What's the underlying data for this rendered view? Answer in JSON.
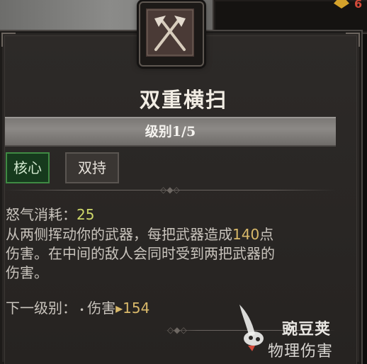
{
  "top_right": {
    "currency_icon": "gold-diamond-icon",
    "value": "6"
  },
  "skill": {
    "icon": "axes-crossed-icon",
    "name": "双重横扫",
    "level_label": "级别1/5",
    "tags": [
      "核心",
      "双持"
    ]
  },
  "stats": {
    "fury_cost_label": "怒气消耗：",
    "fury_cost_value": "25"
  },
  "description": {
    "line1_pre": "从两侧挥动你的武器，每把武器造成",
    "damage_value": "140",
    "line1_post": "点",
    "line2": "伤害。在中间的敌人会同时受到两把武器的",
    "line3": "伤害。"
  },
  "next_level": {
    "label": "下一级别：",
    "bullet": "•",
    "stat_name": "伤害",
    "arrow": "▸",
    "stat_value": "154"
  },
  "watermark": {
    "brand": "豌豆荚",
    "subtitle": "物理伤害"
  },
  "colors": {
    "panel_bg": "#2a2725",
    "highlight": "#d9b96a",
    "core_tag_bg": "#163a1d",
    "core_tag_border": "#3f8a43"
  }
}
